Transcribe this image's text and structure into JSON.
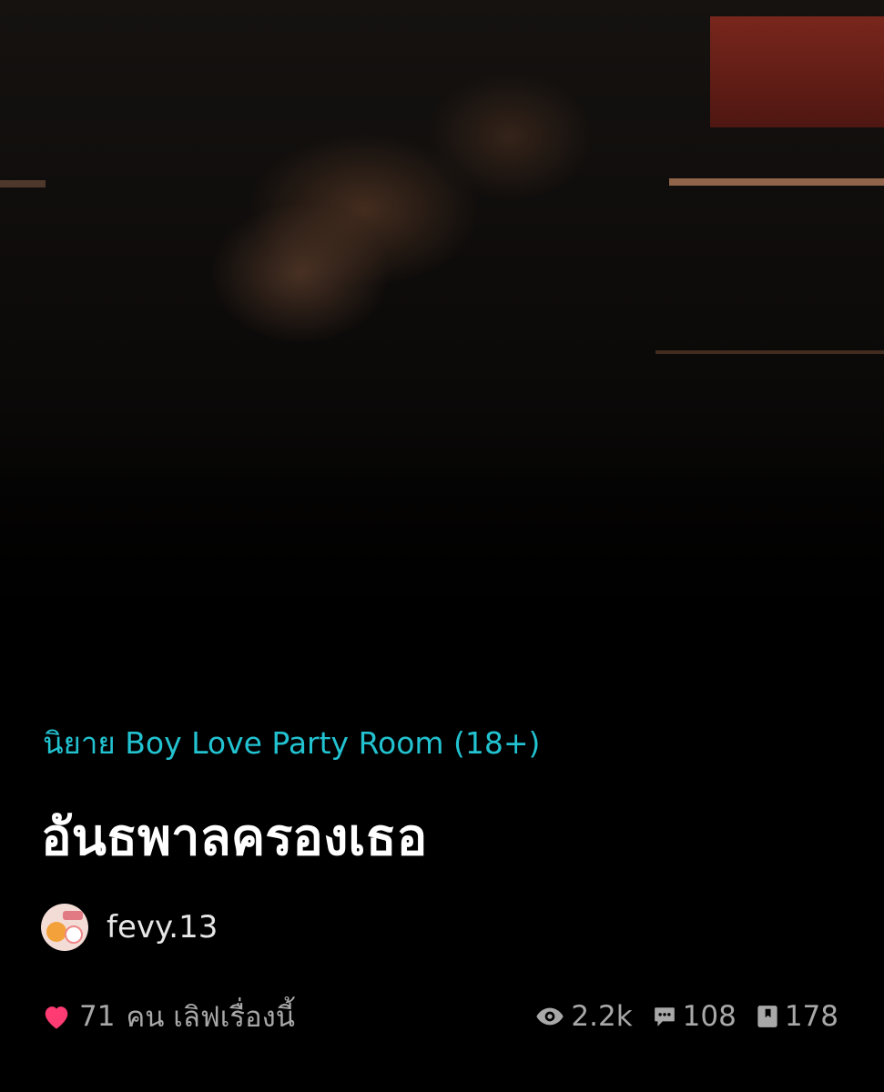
{
  "cover": {
    "image": "cover-photo"
  },
  "story": {
    "category": "นิยาย Boy Love Party Room (18+)",
    "title": "อันธพาลครองเธอ"
  },
  "author": {
    "name": "fevy.13",
    "avatar_icon": "avatar-image"
  },
  "likes": {
    "count": "71",
    "text": "คน เลิฟเรื่องนี้",
    "icon": "heart-icon",
    "color": "#ff3b73"
  },
  "stats": {
    "views": "2.2k",
    "comments": "108",
    "bookmarks": "178"
  },
  "colors": {
    "accent": "#22c2d0",
    "background": "#000000",
    "muted": "#a8a8a8"
  }
}
